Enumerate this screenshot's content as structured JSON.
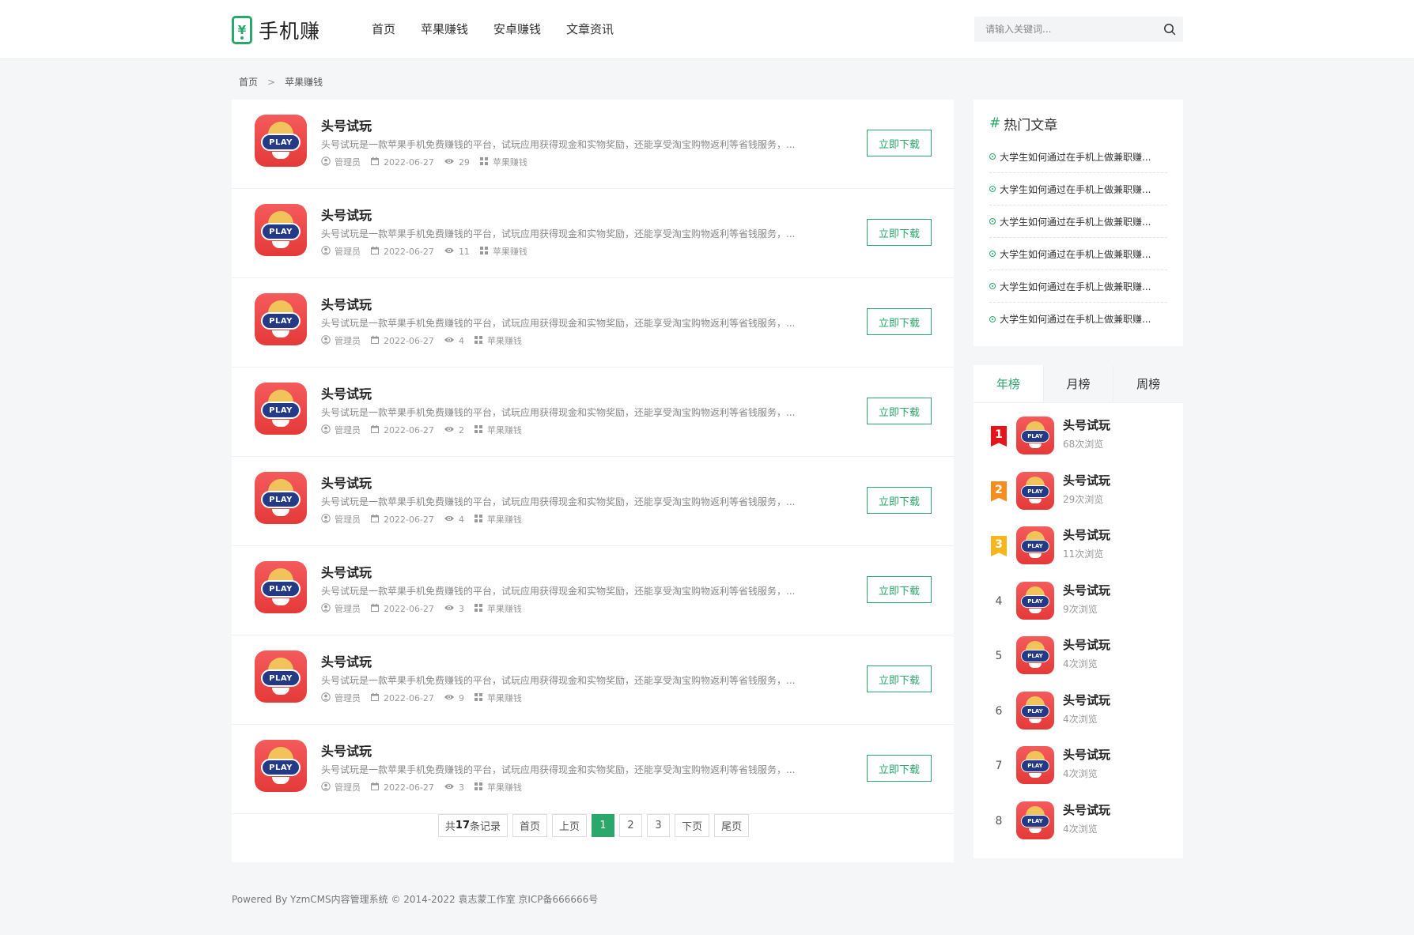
{
  "header": {
    "logo_symbol": "¥",
    "logo_text": "手机赚",
    "nav": [
      "首页",
      "苹果赚钱",
      "安卓赚钱",
      "文章资讯"
    ],
    "search_placeholder": "请输入关键词..."
  },
  "breadcrumb": {
    "home": "首页",
    "separator": ">",
    "current": "苹果赚钱"
  },
  "list": {
    "icon_label": "PLAY",
    "download_label": "立即下载",
    "items": [
      {
        "title": "头号试玩",
        "desc": "头号试玩是一款苹果手机免费赚钱的平台，试玩应用获得现金和实物奖励，还能享受淘宝购物返利等省钱服务，...",
        "author": "管理员",
        "date": "2022-06-27",
        "views": "29",
        "category": "苹果赚钱"
      },
      {
        "title": "头号试玩",
        "desc": "头号试玩是一款苹果手机免费赚钱的平台，试玩应用获得现金和实物奖励，还能享受淘宝购物返利等省钱服务，...",
        "author": "管理员",
        "date": "2022-06-27",
        "views": "11",
        "category": "苹果赚钱"
      },
      {
        "title": "头号试玩",
        "desc": "头号试玩是一款苹果手机免费赚钱的平台，试玩应用获得现金和实物奖励，还能享受淘宝购物返利等省钱服务，...",
        "author": "管理员",
        "date": "2022-06-27",
        "views": "4",
        "category": "苹果赚钱"
      },
      {
        "title": "头号试玩",
        "desc": "头号试玩是一款苹果手机免费赚钱的平台，试玩应用获得现金和实物奖励，还能享受淘宝购物返利等省钱服务，...",
        "author": "管理员",
        "date": "2022-06-27",
        "views": "2",
        "category": "苹果赚钱"
      },
      {
        "title": "头号试玩",
        "desc": "头号试玩是一款苹果手机免费赚钱的平台，试玩应用获得现金和实物奖励，还能享受淘宝购物返利等省钱服务，...",
        "author": "管理员",
        "date": "2022-06-27",
        "views": "4",
        "category": "苹果赚钱"
      },
      {
        "title": "头号试玩",
        "desc": "头号试玩是一款苹果手机免费赚钱的平台，试玩应用获得现金和实物奖励，还能享受淘宝购物返利等省钱服务，...",
        "author": "管理员",
        "date": "2022-06-27",
        "views": "3",
        "category": "苹果赚钱"
      },
      {
        "title": "头号试玩",
        "desc": "头号试玩是一款苹果手机免费赚钱的平台，试玩应用获得现金和实物奖励，还能享受淘宝购物返利等省钱服务，...",
        "author": "管理员",
        "date": "2022-06-27",
        "views": "9",
        "category": "苹果赚钱"
      },
      {
        "title": "头号试玩",
        "desc": "头号试玩是一款苹果手机免费赚钱的平台，试玩应用获得现金和实物奖励，还能享受淘宝购物返利等省钱服务，...",
        "author": "管理员",
        "date": "2022-06-27",
        "views": "3",
        "category": "苹果赚钱"
      }
    ]
  },
  "pagination": {
    "total_prefix": "共",
    "total_count": "17",
    "total_suffix": "条记录",
    "first": "首页",
    "prev": "上页",
    "pages": [
      "1",
      "2",
      "3"
    ],
    "active_page": "1",
    "next": "下页",
    "last": "尾页"
  },
  "hot": {
    "hash": "#",
    "title": "热门文章",
    "items": [
      "大学生如何通过在手机上做兼职赚...",
      "大学生如何通过在手机上做兼职赚...",
      "大学生如何通过在手机上做兼职赚...",
      "大学生如何通过在手机上做兼职赚...",
      "大学生如何通过在手机上做兼职赚...",
      "大学生如何通过在手机上做兼职赚..."
    ]
  },
  "rank": {
    "tabs": [
      "年榜",
      "月榜",
      "周榜"
    ],
    "active_tab": "年榜",
    "icon_label": "PLAY",
    "items": [
      {
        "num": "1",
        "name": "头号试玩",
        "views": "68次浏览"
      },
      {
        "num": "2",
        "name": "头号试玩",
        "views": "29次浏览"
      },
      {
        "num": "3",
        "name": "头号试玩",
        "views": "11次浏览"
      },
      {
        "num": "4",
        "name": "头号试玩",
        "views": "9次浏览"
      },
      {
        "num": "5",
        "name": "头号试玩",
        "views": "4次浏览"
      },
      {
        "num": "6",
        "name": "头号试玩",
        "views": "4次浏览"
      },
      {
        "num": "7",
        "name": "头号试玩",
        "views": "4次浏览"
      },
      {
        "num": "8",
        "name": "头号试玩",
        "views": "4次浏览"
      }
    ]
  },
  "footer": {
    "text": "Powered By YzmCMS内容管理系统 © 2014-2022 袁志蒙工作室    京ICP备666666号"
  },
  "colors": {
    "accent": "#2aa76b",
    "rank1": "#e5141b",
    "rank2": "#f58e1f",
    "rank3": "#f6b61c",
    "icon_red": "#e53939"
  }
}
